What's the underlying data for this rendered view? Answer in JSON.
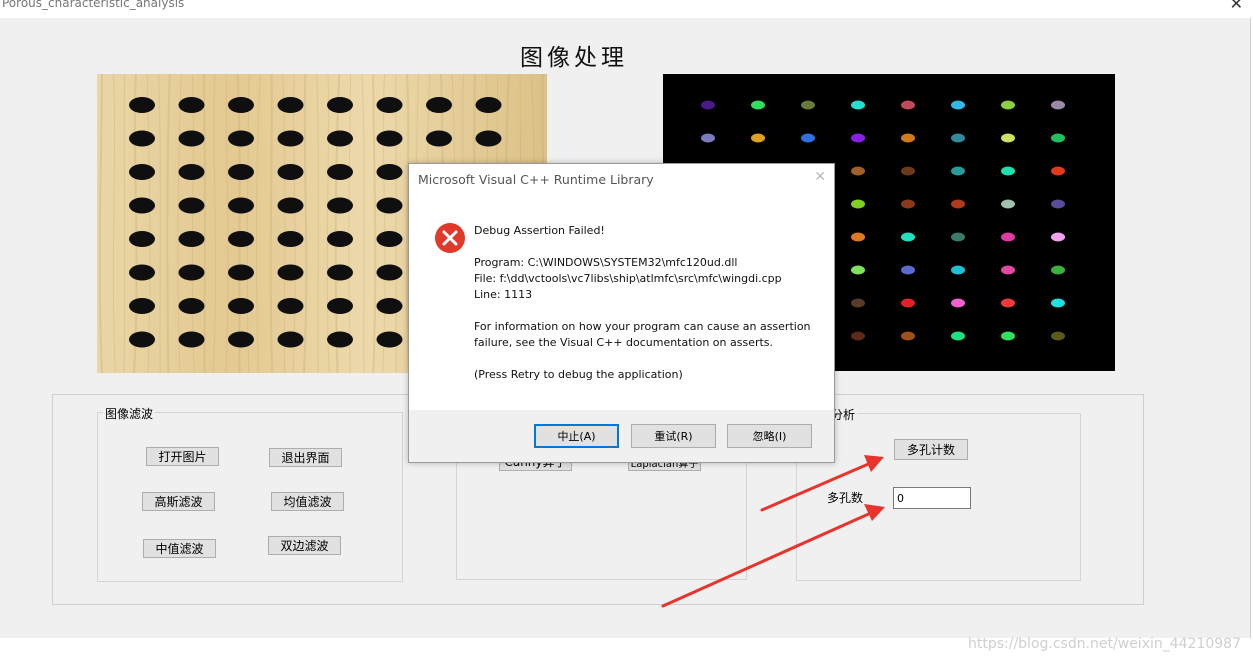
{
  "window": {
    "title": "Porous_characteristic_analysis",
    "close_glyph": "✕"
  },
  "heading": "图像处理",
  "left_image": {
    "type": "perforated wooden board photo",
    "wood_color": "#e6cf9a",
    "hole_color": "#0f0f0f",
    "hole_grid": {
      "rows": 8,
      "cols": 8
    }
  },
  "right_image": {
    "type": "colored labeled blobs on black background",
    "background": "#000000",
    "blob_colors": [
      [
        "#4a1a8a",
        "#2fe060",
        "#6a7a3a",
        "#22e0d0",
        "#c04a5a",
        "#30b8e8",
        "#8ad040",
        "#9a8aa8"
      ],
      [
        "#7a7ac0",
        "#e0a020",
        "#3070e0",
        "#8a20e8",
        "#d07a1a",
        "#308a9a",
        "#d0e060",
        "#20c060"
      ],
      [
        "#1a4a2a",
        "#e03a70",
        "#6a3ab0",
        "#a0602a",
        "#6a3a1a",
        "#2a9a9a",
        "#20e0b0",
        "#e03a1a"
      ],
      [
        "#e0a060",
        "#8a6a1a",
        "#2a5ad0",
        "#80d020",
        "#8a3a1a",
        "#b03a1a",
        "#a0c0b0",
        "#5a4a9a"
      ],
      [
        "#c07a20",
        "#3a3ab0",
        "#8a2ab0",
        "#e07a20",
        "#20e0c0",
        "#3a7a6a",
        "#e03aa0",
        "#f0a0f0"
      ],
      [
        "#6ae040",
        "#c0a020",
        "#1a8a3a",
        "#80e060",
        "#5a6ad0",
        "#20c0d0",
        "#e04aa0",
        "#3ab040"
      ],
      [
        "#2a8a2a",
        "#3a7a20",
        "#3ae0a0",
        "#5a3a2a",
        "#e0202a",
        "#f060d0",
        "#f03a3a",
        "#20e0e0"
      ],
      [
        "#4a2a9a",
        "#8a8a2a",
        "#6a2a1a",
        "#5a2a1a",
        "#a0501a",
        "#20e080",
        "#30e060",
        "#5a5a1a"
      ]
    ]
  },
  "groups": {
    "filter": {
      "label": "图像滤波",
      "buttons": {
        "open_image": "打开图片",
        "exit": "退出界面",
        "gaussian": "高斯滤波",
        "mean": "均值滤波",
        "median": "中值滤波",
        "bilateral": "双边滤波"
      }
    },
    "edge": {
      "canny": "Canny算子",
      "laplacian": "Laplacian算子"
    },
    "analysis": {
      "label_partial": "分析",
      "count_button": "多孔计数",
      "count_label": "多孔数",
      "count_value": "0"
    }
  },
  "dialog": {
    "title": "Microsoft Visual C++ Runtime Library",
    "close_glyph": "✕",
    "icon": "error-icon",
    "heading": "Debug Assertion Failed!",
    "program": "Program: C:\\WINDOWS\\SYSTEM32\\mfc120ud.dll",
    "file": "File: f:\\dd\\vctools\\vc7libs\\ship\\atlmfc\\src\\mfc\\wingdi.cpp",
    "line": "Line: 1113",
    "info1": "For information on how your program can cause an assertion",
    "info2": "failure, see the Visual C++ documentation on asserts.",
    "retry_note": "(Press Retry to debug the application)",
    "buttons": {
      "abort": "中止(A)",
      "retry": "重试(R)",
      "ignore": "忽略(I)"
    }
  },
  "annotation": {
    "arrow_color": "#e8342c"
  },
  "watermark": "https://blog.csdn.net/weixin_44210987"
}
